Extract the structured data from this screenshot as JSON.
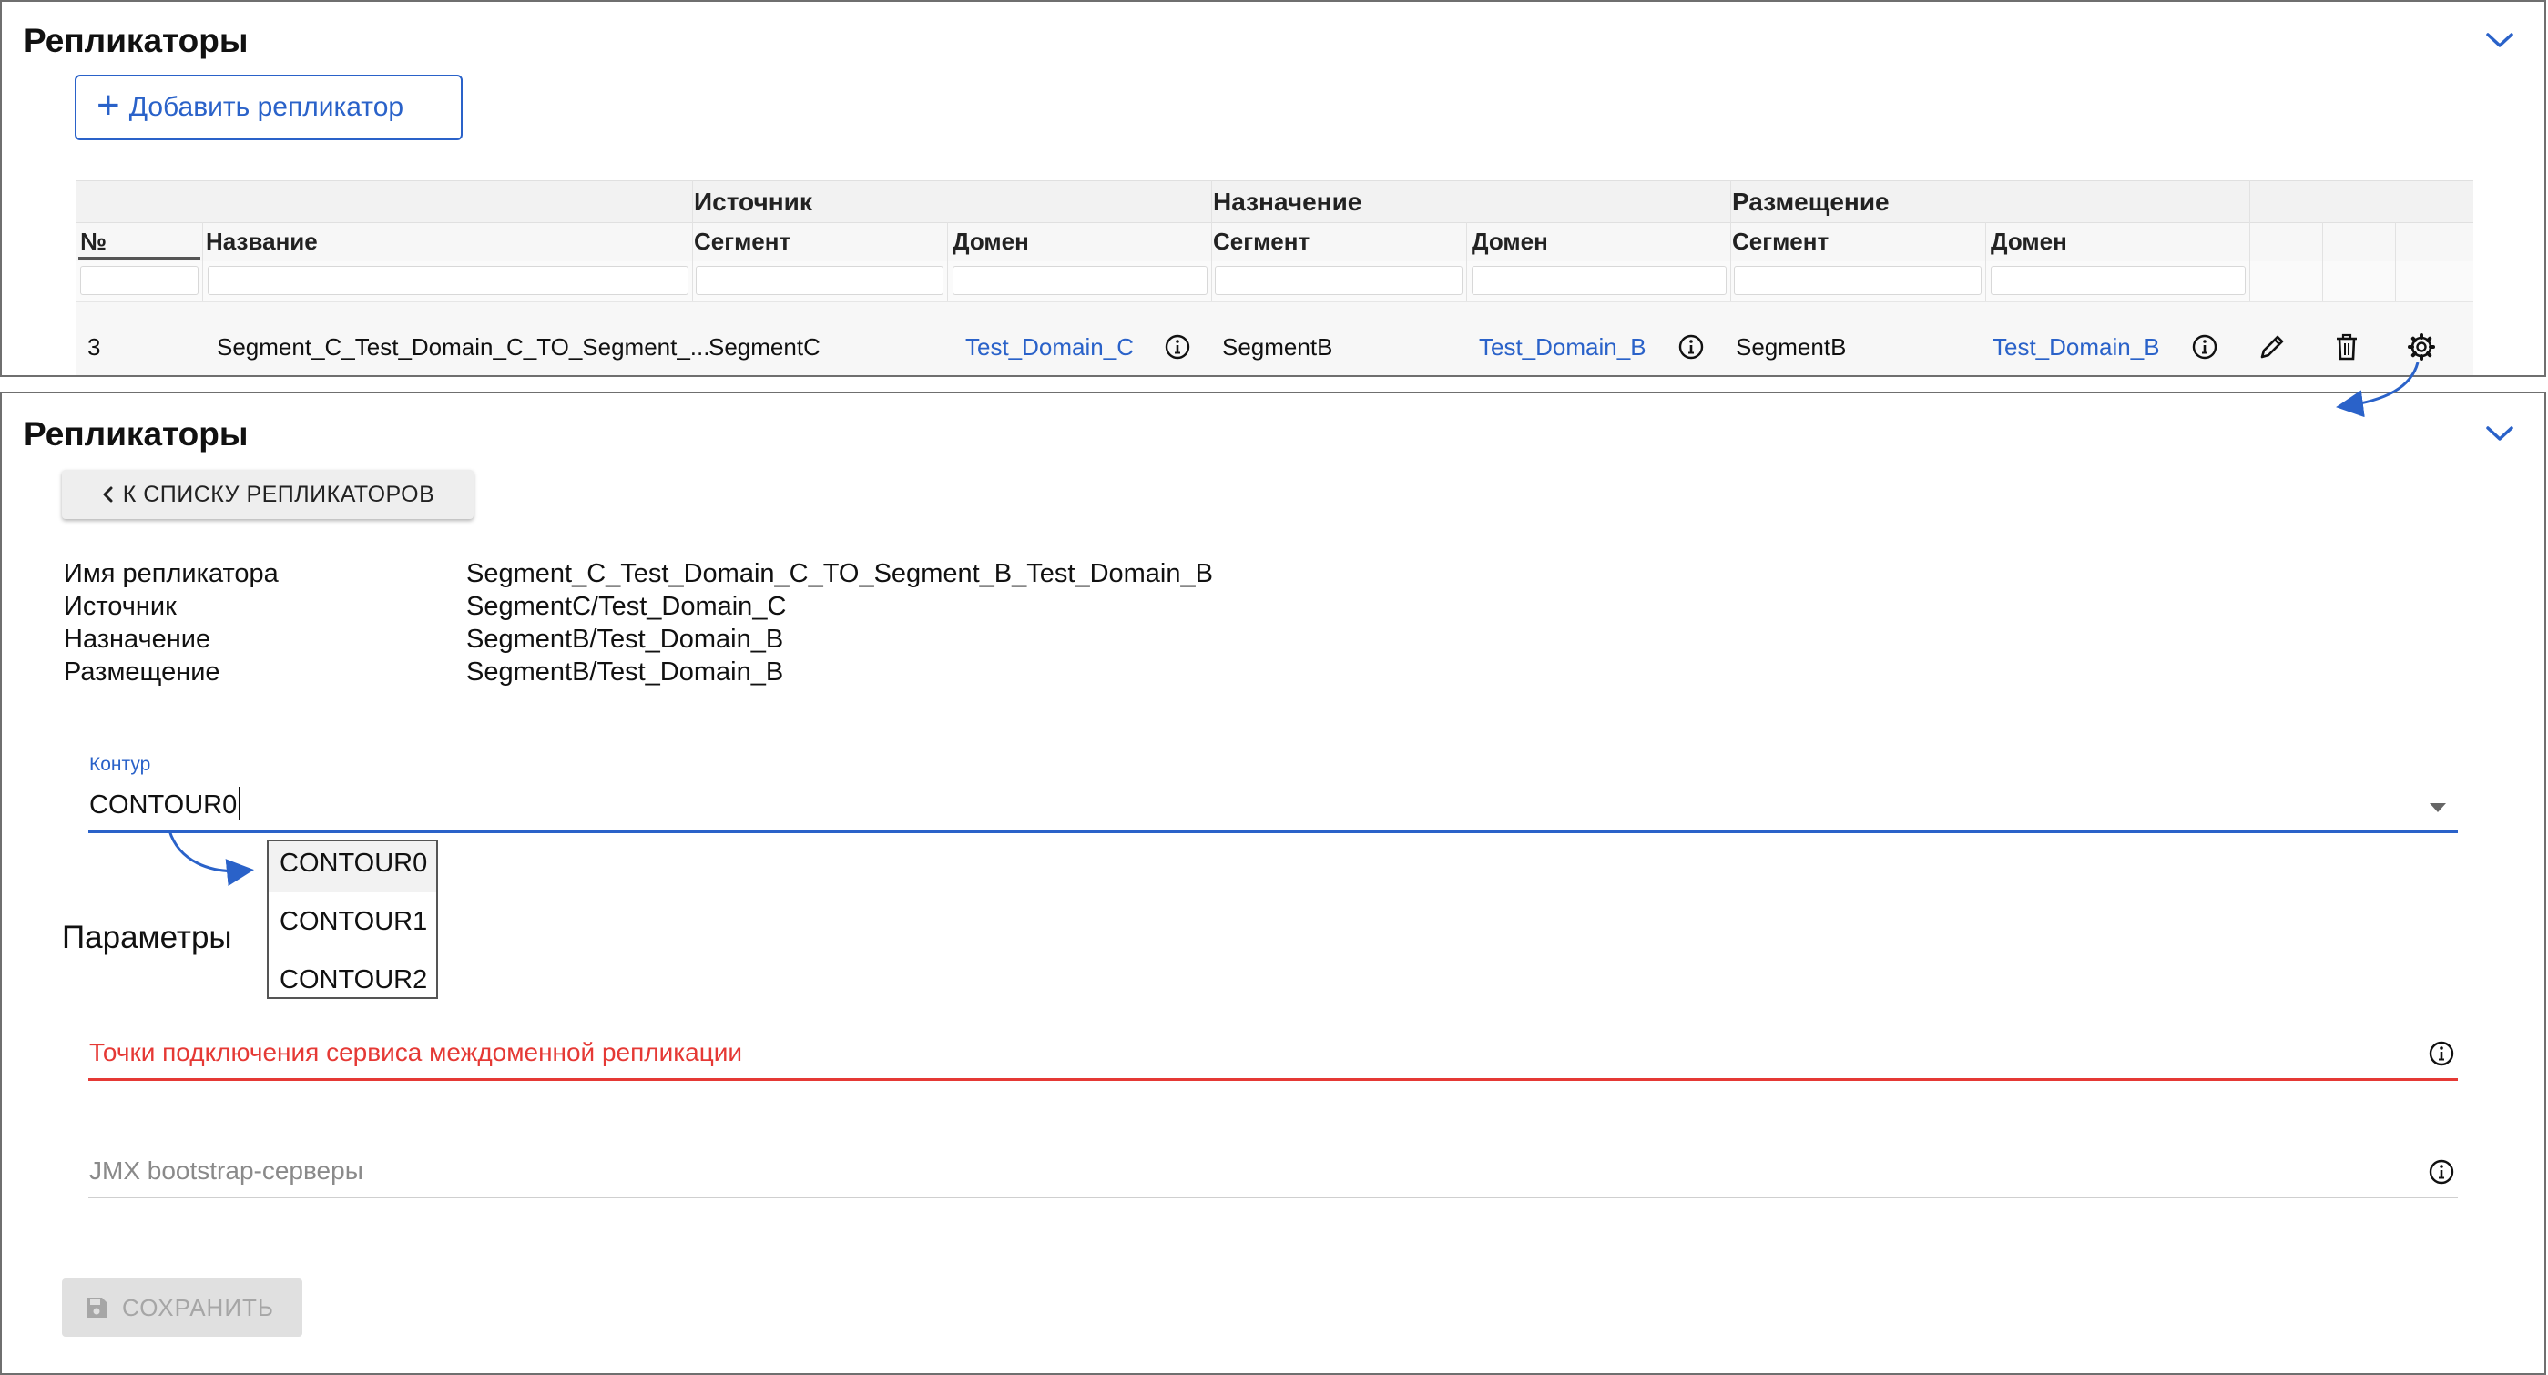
{
  "panel1": {
    "title": "Репликаторы",
    "add_button": "Добавить репликатор",
    "table": {
      "groups": [
        "Источник",
        "Назначение",
        "Размещение"
      ],
      "columns": {
        "num": "№",
        "name": "Название",
        "src_segment": "Сегмент",
        "src_domain": "Домен",
        "dst_segment": "Сегмент",
        "dst_domain": "Домен",
        "plc_segment": "Сегмент",
        "plc_domain": "Домен"
      },
      "row": {
        "num": "3",
        "name": "Segment_C_Test_Domain_C_TO_Segment_...",
        "src_segment": "SegmentC",
        "src_domain": "Test_Domain_C",
        "dst_segment": "SegmentB",
        "dst_domain": "Test_Domain_B",
        "plc_segment": "SegmentB",
        "plc_domain": "Test_Domain_B"
      }
    }
  },
  "panel2": {
    "title": "Репликаторы",
    "back_button": "К СПИСКУ РЕПЛИКАТОРОВ",
    "info": {
      "name_label": "Имя репликатора",
      "name_value": "Segment_C_Test_Domain_C_TO_Segment_B_Test_Domain_B",
      "source_label": "Источник",
      "source_value": "SegmentC/Test_Domain_C",
      "dest_label": "Назначение",
      "dest_value": "SegmentB/Test_Domain_B",
      "placement_label": "Размещение",
      "placement_value": "SegmentB/Test_Domain_B"
    },
    "contour": {
      "label": "Контур",
      "value": "CONTOUR0",
      "options": [
        "CONTOUR0",
        "CONTOUR1",
        "CONTOUR2"
      ]
    },
    "params_title": "Параметры",
    "endpoints_field": "Точки подключения сервиса междоменной репликации",
    "jmx_field": "JMX bootstrap-серверы",
    "save_button": "СОХРАНИТЬ"
  },
  "colors": {
    "accent": "#2a62c9",
    "error": "#e53935",
    "disabled": "#a6a6a6"
  }
}
